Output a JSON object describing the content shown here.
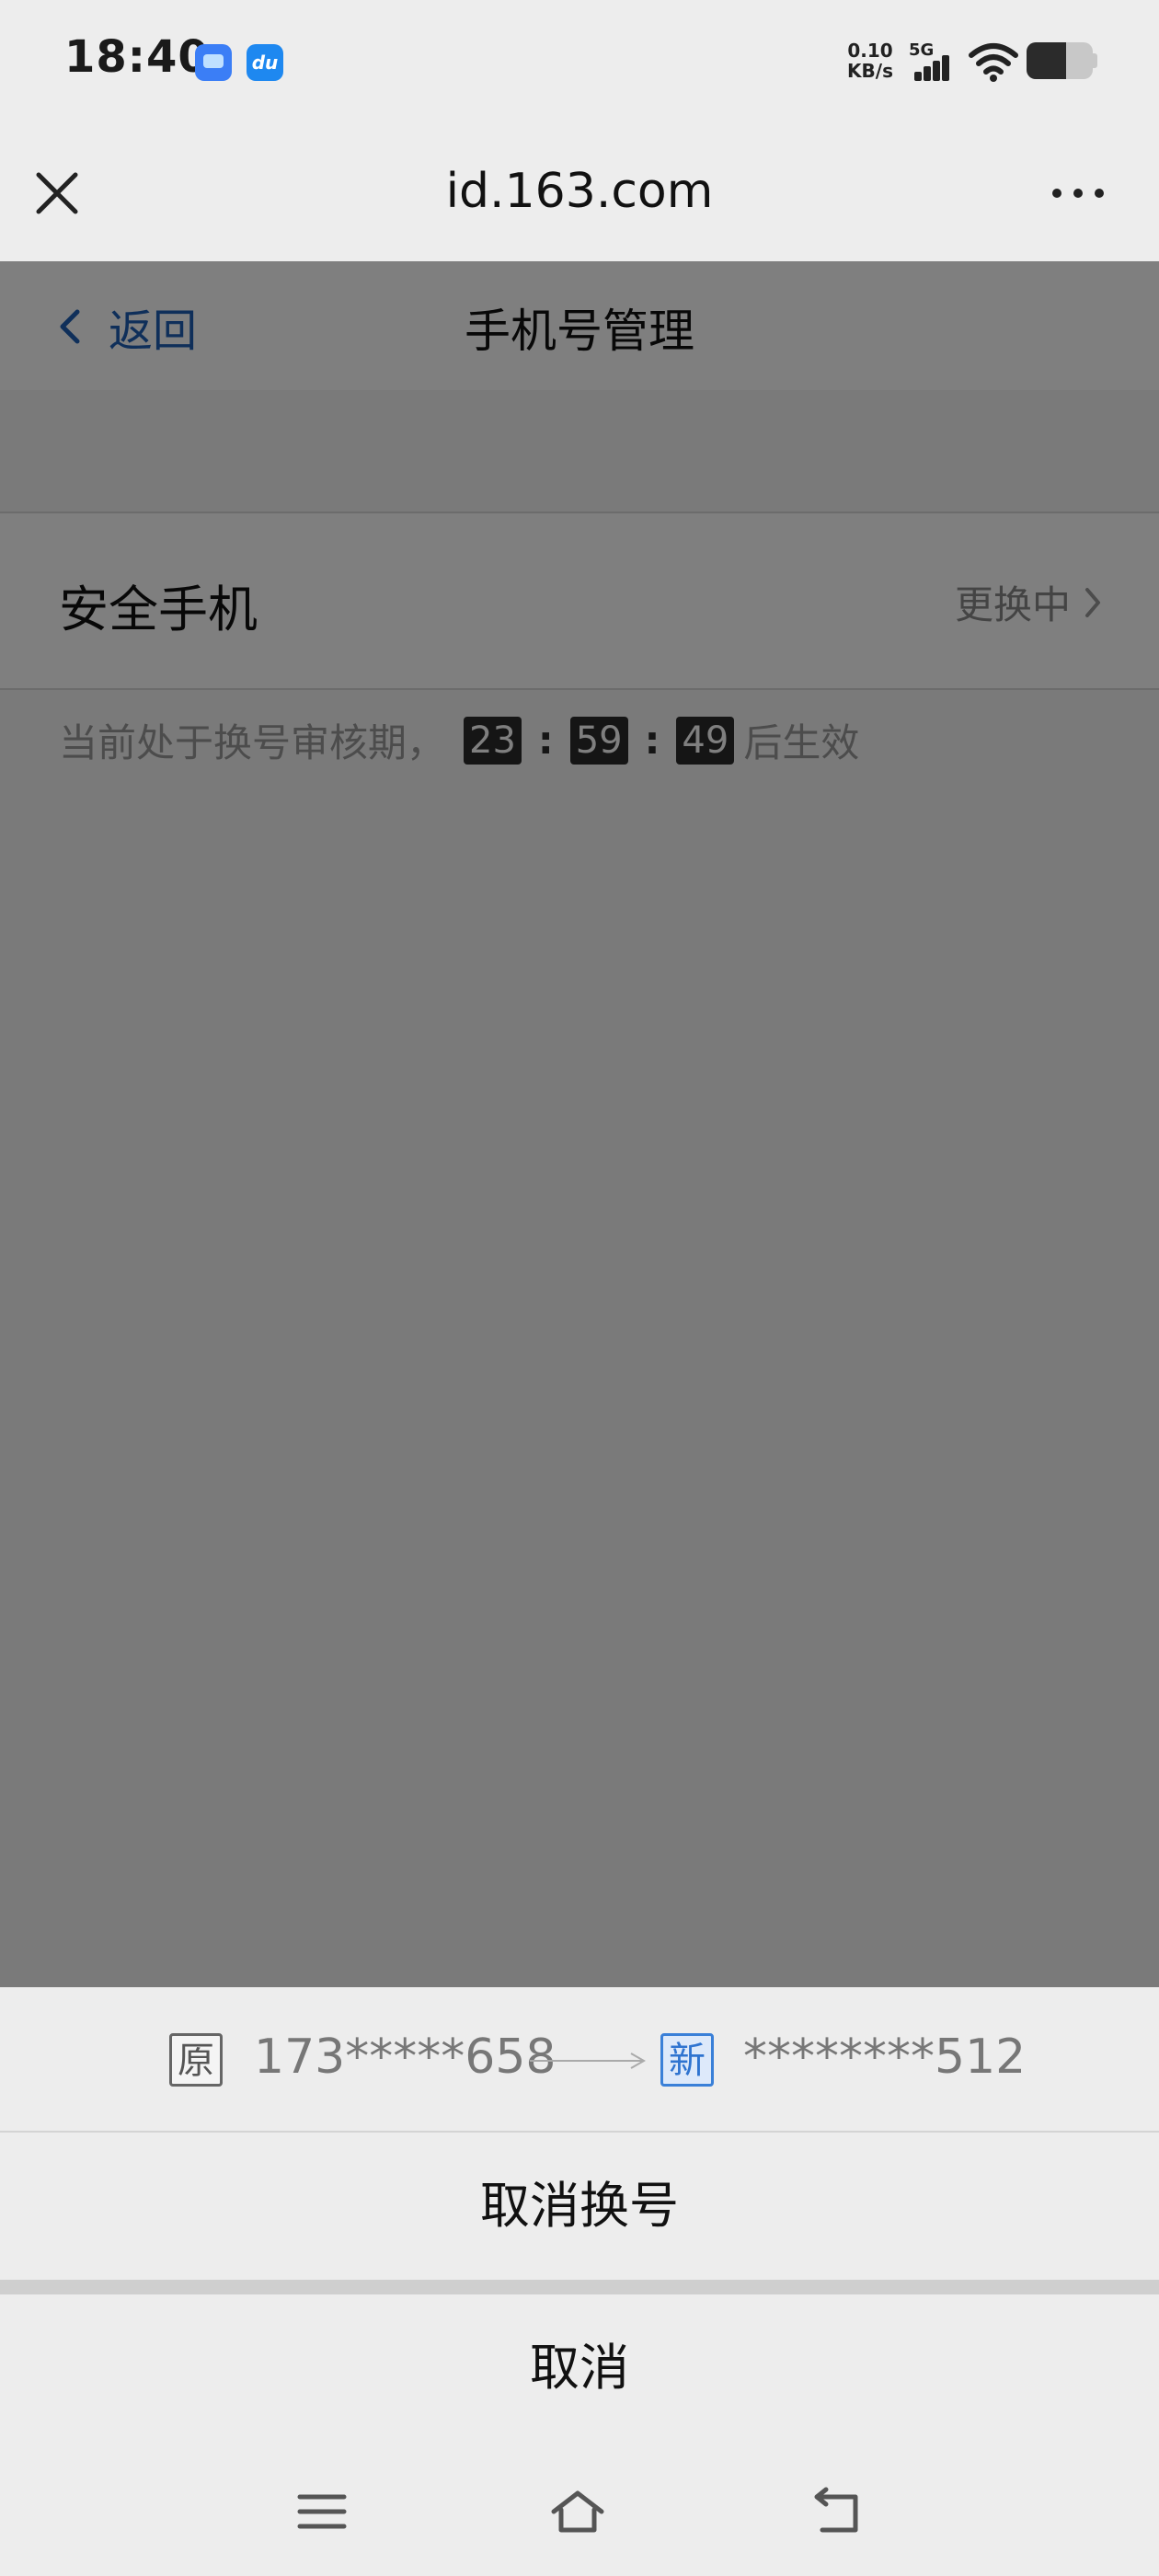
{
  "status_bar": {
    "time": "18:40",
    "net_speed_value": "0.10",
    "net_speed_unit": "KB/s",
    "network_type": "5G",
    "battery_level": 0.6,
    "notification_icons": [
      "messenger-icon",
      "du-app-icon"
    ],
    "du_icon_text": "du"
  },
  "browser": {
    "url": "id.163.com",
    "close_icon": "close-icon",
    "more_icon": "more-dots-icon"
  },
  "page": {
    "back_label": "返回",
    "title": "手机号管理",
    "row_label": "安全手机",
    "row_status": "更换中",
    "review_prefix": "当前处于换号审核期，",
    "countdown": {
      "hours": "23",
      "minutes": "59",
      "seconds": "49",
      "separator": ":"
    },
    "review_suffix": "后生效"
  },
  "sheet": {
    "old_badge": "原",
    "old_number": "173*****658",
    "new_badge": "新",
    "new_number": "********512",
    "cancel_change_label": "取消换号",
    "cancel_label": "取消"
  },
  "colors": {
    "link_blue": "#1f5fb5",
    "new_badge_blue": "#2f74d0",
    "overlay": "rgba(0,0,0,0.5)"
  }
}
